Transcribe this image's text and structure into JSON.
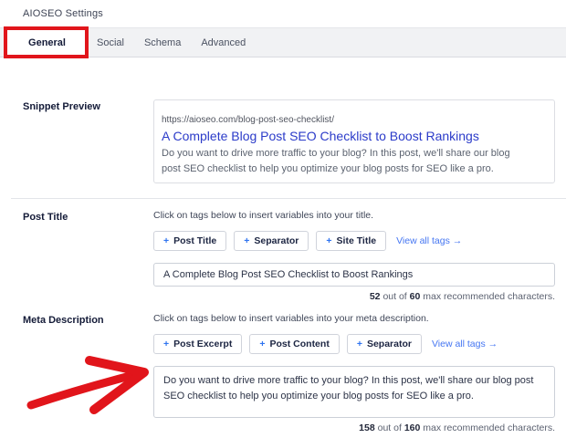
{
  "window": {
    "title": "AIOSEO Settings"
  },
  "tabs": [
    {
      "label": "General",
      "active": true
    },
    {
      "label": "Social",
      "active": false
    },
    {
      "label": "Schema",
      "active": false
    },
    {
      "label": "Advanced",
      "active": false
    }
  ],
  "snippet_preview": {
    "label": "Snippet Preview",
    "url": "https://aioseo.com/blog-post-seo-checklist/",
    "title": "A Complete Blog Post SEO Checklist to Boost Rankings",
    "description": "Do you want to drive more traffic to your blog? In this post, we'll share our blog post SEO checklist to help you optimize your blog posts for SEO like a pro."
  },
  "post_title": {
    "label": "Post Title",
    "helper": "Click on tags below to insert variables into your title.",
    "tags": [
      "Post Title",
      "Separator",
      "Site Title"
    ],
    "view_all": "View all tags →",
    "value": "A Complete Blog Post SEO Checklist to Boost Rankings",
    "count": {
      "current": "52",
      "out_of": "out of",
      "max": "60",
      "suffix": "max recommended characters."
    }
  },
  "meta_description": {
    "label": "Meta Description",
    "helper": "Click on tags below to insert variables into your meta description.",
    "tags": [
      "Post Excerpt",
      "Post Content",
      "Separator"
    ],
    "view_all": "View all tags →",
    "value": "Do you want to drive more traffic to your blog? In this post, we'll share our blog post SEO checklist to help you optimize your blog posts for SEO like a pro.",
    "count": {
      "current": "158",
      "out_of": "out of",
      "max": "160",
      "suffix": "max recommended characters."
    }
  },
  "icons": {
    "plus": "+"
  },
  "annotations": {
    "highlight_color": "#e1151b",
    "highlighted_tab": "General",
    "arrow_target": "meta-description-textarea"
  }
}
